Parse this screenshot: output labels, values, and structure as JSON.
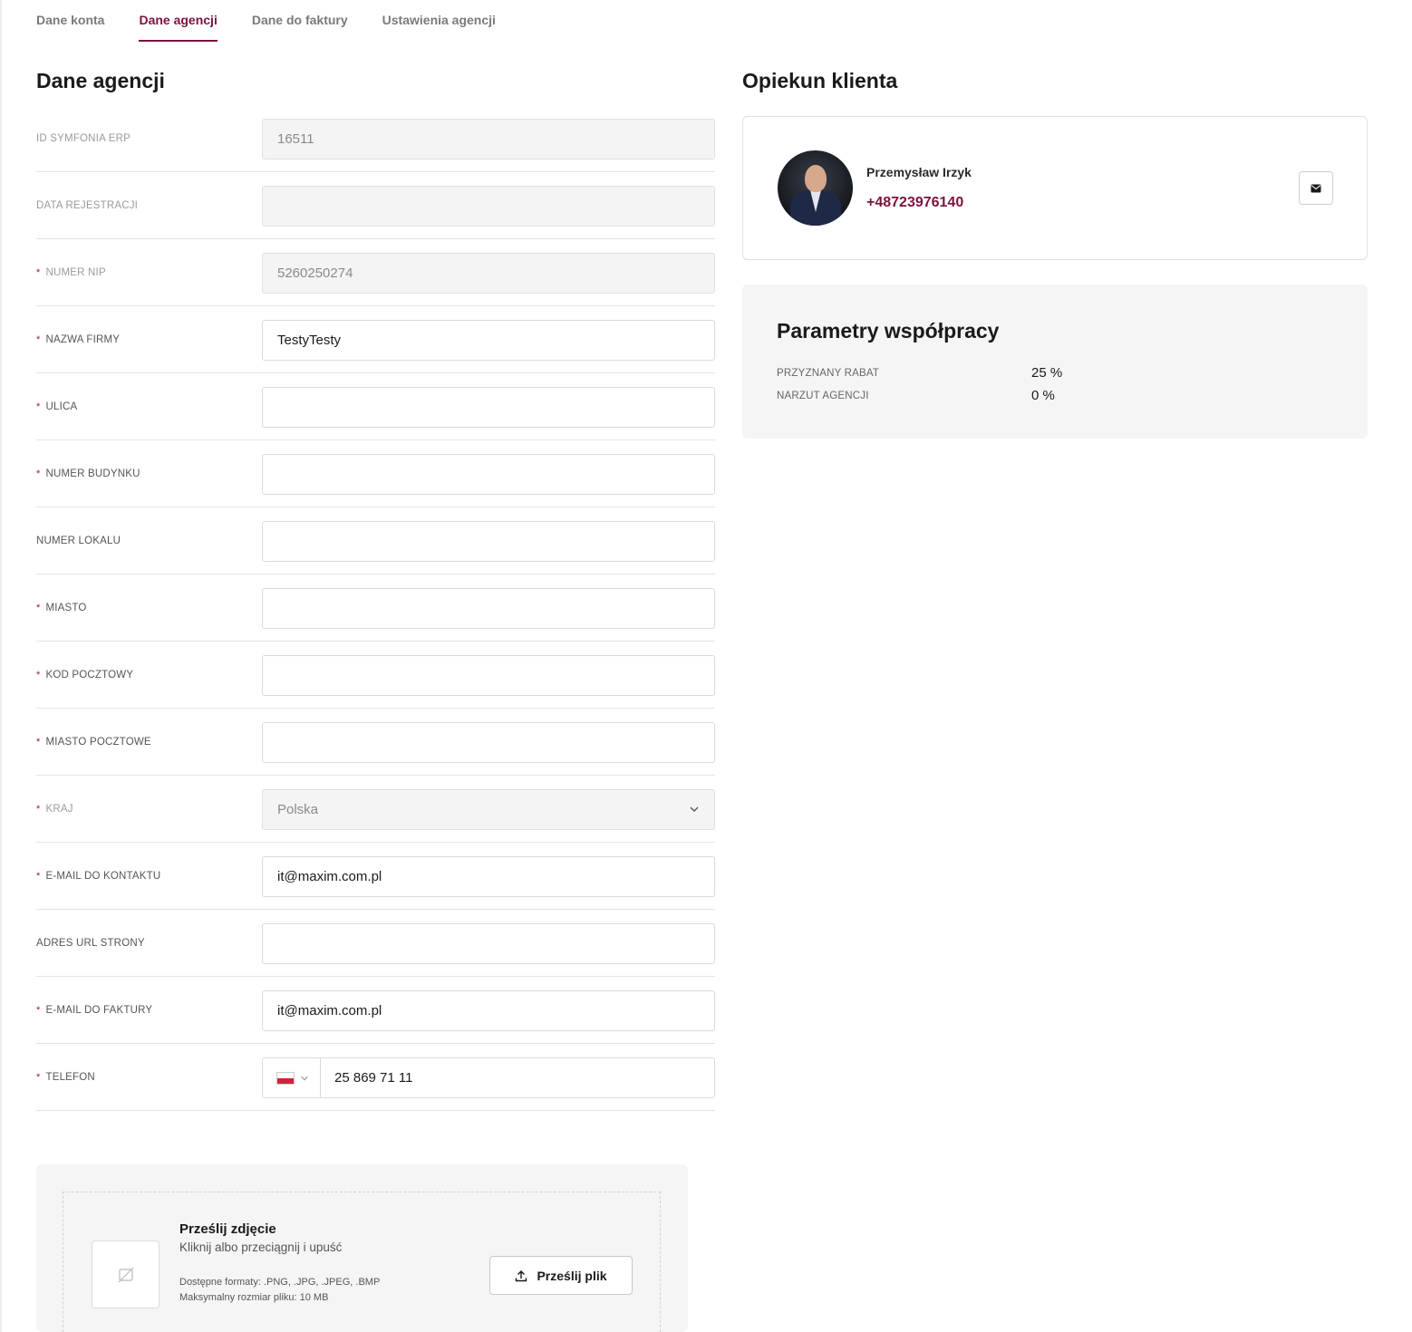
{
  "tabs": [
    {
      "label": "Dane konta"
    },
    {
      "label": "Dane agencji"
    },
    {
      "label": "Dane do faktury"
    },
    {
      "label": "Ustawienia agencji"
    }
  ],
  "form": {
    "title": "Dane agencji",
    "rows": [
      {
        "label": "ID SYMFONIA ERP",
        "required": false,
        "value": "16511",
        "disabled": true
      },
      {
        "label": "DATA REJESTRACJI",
        "required": false,
        "value": "",
        "disabled": true
      },
      {
        "label": "NUMER NIP",
        "required": true,
        "value": "5260250274",
        "disabled": true
      },
      {
        "label": "NAZWA FIRMY",
        "required": true,
        "value": "TestyTesty",
        "disabled": false
      },
      {
        "label": "ULICA",
        "required": true,
        "value": "",
        "disabled": false
      },
      {
        "label": "NUMER BUDYNKU",
        "required": true,
        "value": "",
        "disabled": false
      },
      {
        "label": "NUMER LOKALU",
        "required": false,
        "value": "",
        "disabled": false
      },
      {
        "label": "MIASTO",
        "required": true,
        "value": "",
        "disabled": false
      },
      {
        "label": "KOD POCZTOWY",
        "required": true,
        "value": "",
        "disabled": false
      },
      {
        "label": "MIASTO POCZTOWE",
        "required": true,
        "value": "",
        "disabled": false
      },
      {
        "label": "KRAJ",
        "required": true,
        "value": "Polska",
        "disabled": true
      },
      {
        "label": "E-MAIL DO KONTAKTU",
        "required": true,
        "value": "it@maxim.com.pl",
        "disabled": false
      },
      {
        "label": "ADRES URL STRONY",
        "required": false,
        "value": "",
        "disabled": false
      },
      {
        "label": "E-MAIL DO FAKTURY",
        "required": true,
        "value": "it@maxim.com.pl",
        "disabled": false
      },
      {
        "label": "TELEFON",
        "required": true,
        "value": "25 869 71 11",
        "disabled": false
      }
    ],
    "required_mark": "*"
  },
  "manager": {
    "title": "Opiekun klienta",
    "name": "Przemysław Irzyk",
    "phone": "+48723976140"
  },
  "params": {
    "title": "Parametry współpracy",
    "discount_label": "PRZYZNANY RABAT",
    "discount_value": "25 %",
    "markup_label": "NARZUT AGENCJI",
    "markup_value": "0 %"
  },
  "upload": {
    "title": "Prześlij zdjęcie",
    "subtitle": "Kliknij albo przeciągnij i upuść",
    "formats": "Dostępne formaty: .PNG, .JPG, .JPEG, .BMP",
    "max_size": "Maksymalny rozmiar pliku: 10 MB",
    "button_label": "Prześlij plik"
  },
  "colors": {
    "accent": "#7b1240",
    "required": "#b0103a"
  }
}
